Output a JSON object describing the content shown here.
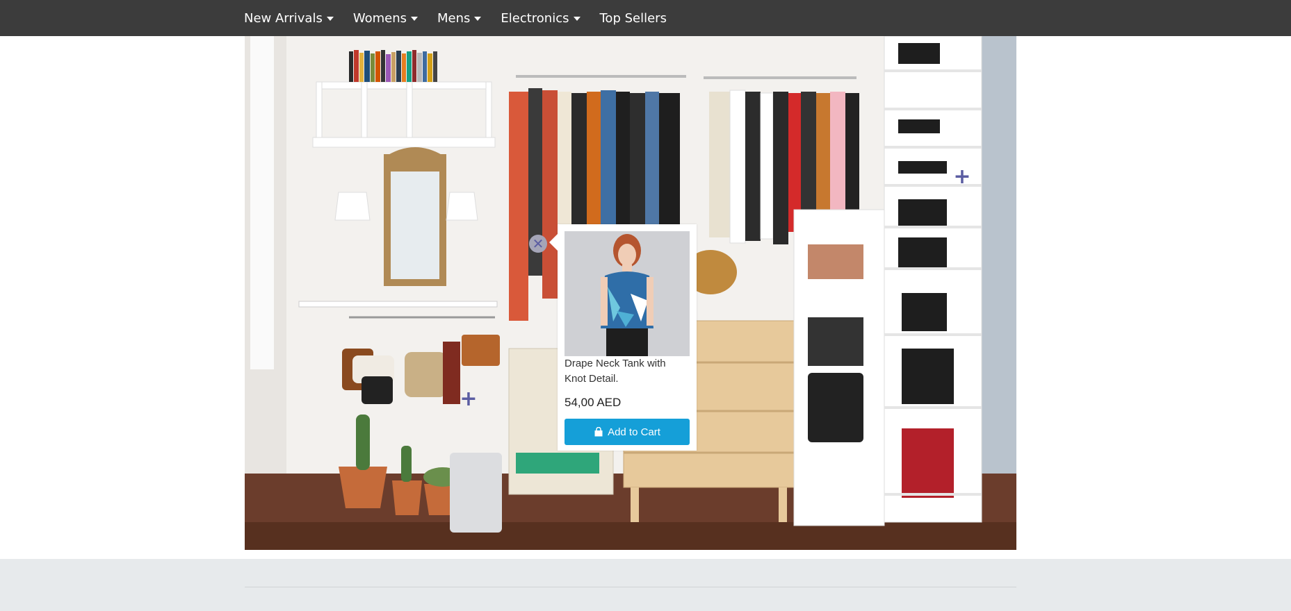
{
  "navbar": {
    "items": [
      {
        "label": "New Arrivals",
        "dropdown": true
      },
      {
        "label": "Womens",
        "dropdown": true
      },
      {
        "label": "Mens",
        "dropdown": true
      },
      {
        "label": "Electronics",
        "dropdown": true
      },
      {
        "label": "Top Sellers",
        "dropdown": false
      }
    ]
  },
  "hero": {
    "icons": {
      "hotspot": "plus-icon",
      "close": "close-icon"
    }
  },
  "popup": {
    "product_name": "Drape Neck Tank with Knot Detail.",
    "price": "54,00 AED",
    "add_to_cart_label": "Add to Cart",
    "button_icon": "shopping-bag-icon"
  },
  "colors": {
    "navbar": "#3c3c3c",
    "button": "#159fd8",
    "hotspot": "#5b5da2",
    "footer": "#e7eaec"
  }
}
